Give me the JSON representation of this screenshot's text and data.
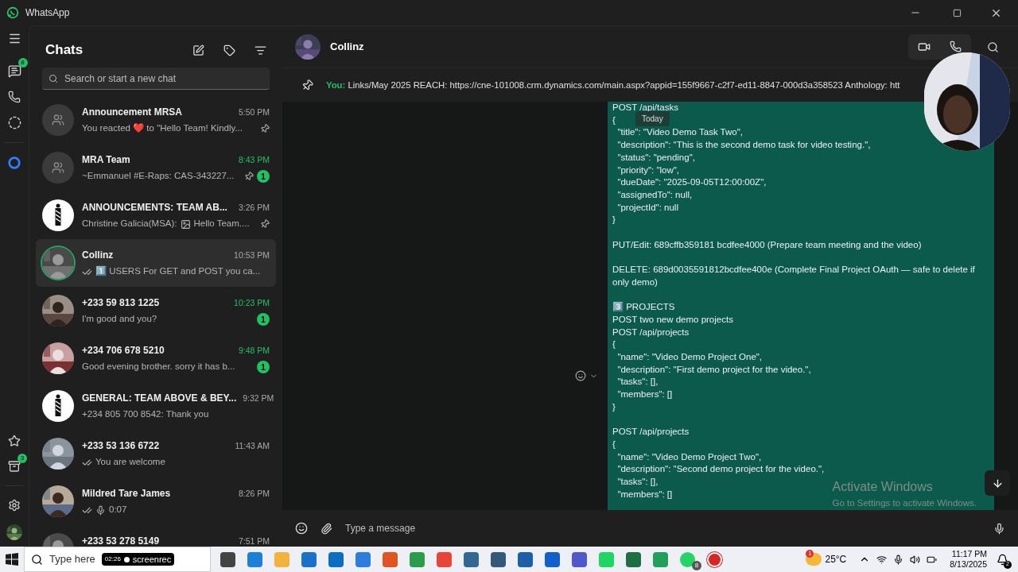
{
  "title_bar": {
    "app": "WhatsApp"
  },
  "nav_rail": {
    "chats_badge": "8",
    "archive_badge": "3"
  },
  "chats_panel": {
    "title": "Chats",
    "search": {
      "placeholder": "Search or start a new chat"
    },
    "chats": [
      {
        "name": "Announcement MRSA",
        "time": "5:50 PM",
        "preview": "You reacted ❤️ to \"Hello Team!  Kindly...",
        "kind": "group",
        "pinned": true,
        "ticks": false,
        "image_icon": false,
        "voice_note": false,
        "selected": false
      },
      {
        "name": "MRA Team",
        "time": "8:43 PM",
        "preview": "~Emmanuel #E-Raps: CAS-343227...",
        "kind": "group",
        "pinned": true,
        "unread": "1",
        "ticks": false,
        "image_icon": false,
        "voice_note": false,
        "selected": false
      },
      {
        "name": "ANNOUNCEMENTS: TEAM AB...",
        "time": "3:26 PM",
        "preview_before": "Christine Galicia(MSA):",
        "preview": "Hello Team....",
        "kind": "logo",
        "pinned": true,
        "ticks": false,
        "image_icon": true,
        "voice_note": false,
        "selected": false
      },
      {
        "name": "Collinz",
        "time": "10:53 PM",
        "preview": "1️⃣ USERS  For GET and POST you ca...",
        "pinned": false,
        "ticks": true,
        "image_icon": false,
        "voice_note": false,
        "selected": true
      },
      {
        "name": "+233 59 813 1225",
        "time": "10:23 PM",
        "preview": "I'm good and you?",
        "pinned": false,
        "unread": "1",
        "ticks": false,
        "image_icon": false,
        "voice_note": false,
        "selected": false
      },
      {
        "name": "+234 706 678 5210",
        "time": "9:48 PM",
        "preview": "Good evening brother.   sorry it has b...",
        "pinned": false,
        "unread": "1",
        "ticks": false,
        "image_icon": false,
        "voice_note": false,
        "selected": false
      },
      {
        "name": "GENERAL: TEAM ABOVE & BEY...",
        "time": "9:32 PM",
        "preview": "+234 805 700 8542: Thank you",
        "kind": "logo",
        "pinned": false,
        "ticks": false,
        "image_icon": false,
        "voice_note": false,
        "selected": false
      },
      {
        "name": "+233 53 136 6722",
        "time": "11:43 AM",
        "preview": "You are welcome",
        "pinned": false,
        "ticks": true,
        "image_icon": false,
        "voice_note": false,
        "selected": false
      },
      {
        "name": "Mildred Tare James",
        "time": "8:26 PM",
        "preview": "0:07",
        "pinned": false,
        "ticks": true,
        "image_icon": false,
        "voice_note": true,
        "selected": false
      },
      {
        "name": "+233 53 278 5149",
        "time": "7:51 PM",
        "pinned": false,
        "ticks": false,
        "image_icon": false,
        "voice_note": false,
        "selected": false
      }
    ]
  },
  "conversation": {
    "name": "Collinz",
    "pinned": {
      "sender": "You:",
      "text": "Links/May 2025  REACH: https://cne-101008.crm.dynamics.com/main.aspx?appid=155f9667-c2f7-ed11-8847-000d3a358523  Anthology: htt"
    },
    "date_chip": "Today",
    "message_blocks": [
      [
        "POST /api/tasks",
        "{",
        "  \"title\": \"Video Demo Task Two\",",
        "  \"description\": \"This is the second demo task for video testing.\",",
        "  \"status\": \"pending\",",
        "  \"priority\": \"low\",",
        "  \"dueDate\": \"2025-09-05T12:00:00Z\",",
        "  \"assignedTo\": null,",
        "  \"projectId\": null",
        "}"
      ],
      [
        "PUT/Edit: 689cffb359181 bcdfee4000 (Prepare team meeting and the video)"
      ],
      [
        "DELETE: 689d0035591812bcdfee400e (Complete Final Project OAuth — safe to delete if only demo)"
      ],
      [
        "3️⃣ PROJECTS",
        "POST two new demo projects",
        "POST /api/projects",
        "{",
        "  \"name\": \"Video Demo Project One\",",
        "  \"description\": \"First demo project for the video.\",",
        "  \"tasks\": [],",
        "  \"members\": []",
        "}"
      ],
      [
        "POST /api/projects",
        "{",
        "  \"name\": \"Video Demo Project Two\",",
        "  \"description\": \"Second demo project for the video.\",",
        "  \"tasks\": [],",
        "  \"members\": []"
      ]
    ],
    "composer": {
      "placeholder": "Type a message"
    }
  },
  "activation_notice": {
    "title": "Activate Windows",
    "subtitle": "Go to Settings to activate Windows."
  },
  "taskbar": {
    "search": "Type here",
    "recorder": "screenrec",
    "recorder_time": "02:26",
    "app_badge": "8",
    "weather": "25°C",
    "weather_badge": "1",
    "time": "11:17 PM",
    "date": "8/13/2025",
    "notifications": "2"
  }
}
